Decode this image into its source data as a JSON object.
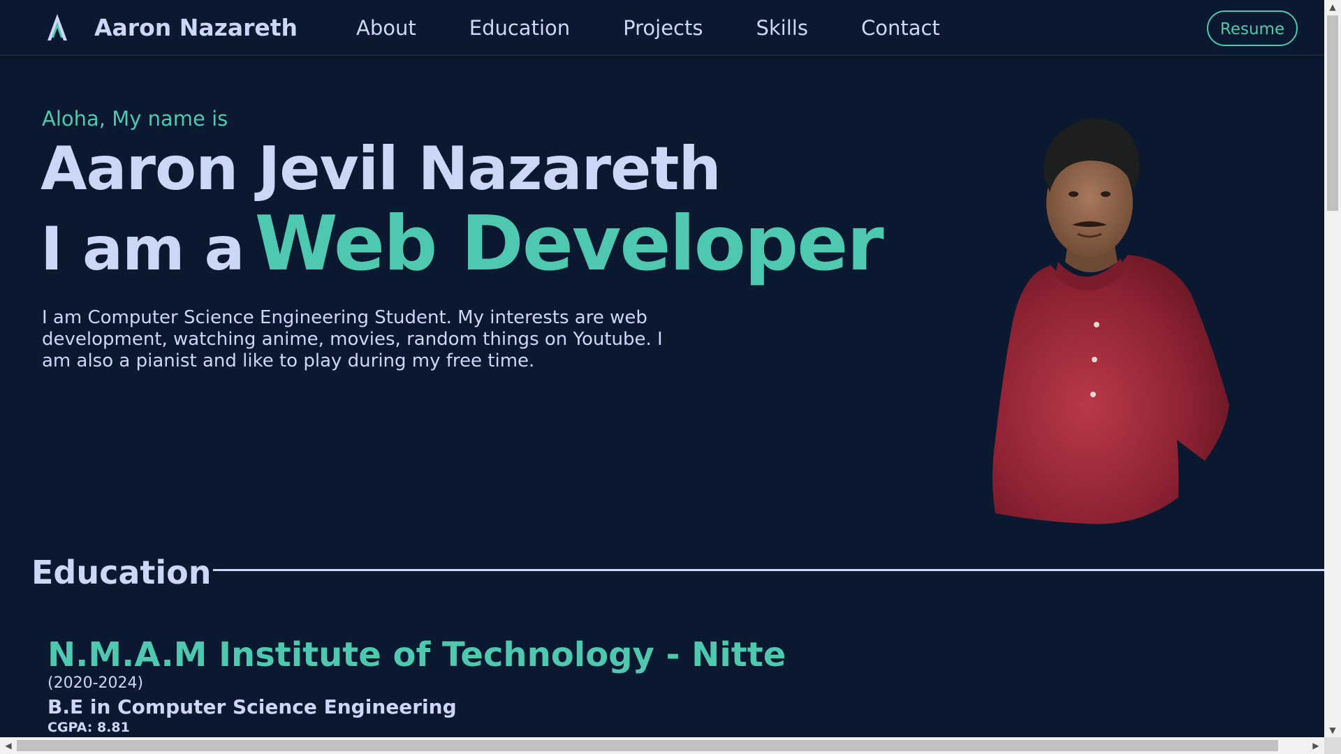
{
  "navbar": {
    "brand": "Aaron Nazareth",
    "links": [
      "About",
      "Education",
      "Projects",
      "Skills",
      "Contact"
    ],
    "resume_label": "Resume"
  },
  "hero": {
    "greeting": "Aloha, My name is",
    "name": "Aaron Jevil Nazareth",
    "role_prefix": "I am a",
    "role_title": "Web Developer",
    "description": "I am Computer Science Engineering Student. My interests are web development, watching anime, movies, random things on Youtube. I am also a pianist and like to play during my free time."
  },
  "education": {
    "section_title": "Education",
    "items": [
      {
        "school": "N.M.A.M Institute of Technology - Nitte",
        "years": "(2020-2024)",
        "degree": "B.E in Computer Science Engineering",
        "gpa": "CGPA: 8.81"
      }
    ]
  },
  "colors": {
    "background": "#0a192f",
    "text": "#ccd6f6",
    "accent": "#4ec9b0"
  }
}
